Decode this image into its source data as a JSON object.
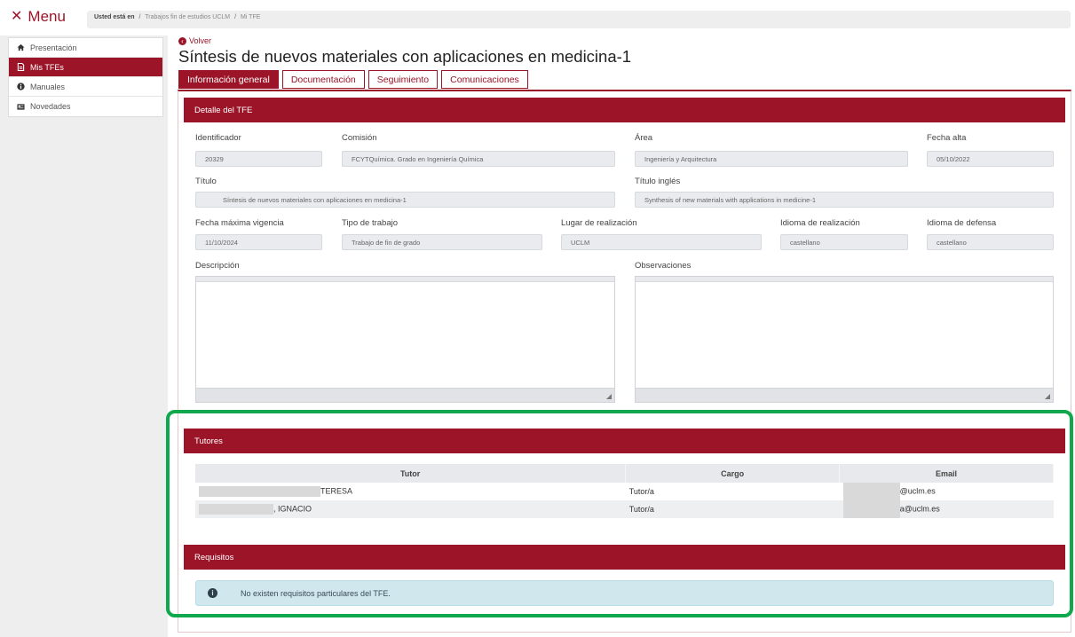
{
  "header": {
    "menu_label": "Menu",
    "breadcrumb": {
      "lead": "Usted está en",
      "sep": "/",
      "items": [
        "Trabajos fin de estudios UCLM",
        "Mi TFE"
      ]
    }
  },
  "sidebar": {
    "items": [
      {
        "label": "Presentación",
        "icon": "home-icon"
      },
      {
        "label": "Mis TFEs",
        "icon": "document-icon",
        "active": true
      },
      {
        "label": "Manuales",
        "icon": "info-icon"
      },
      {
        "label": "Novedades",
        "icon": "news-icon"
      }
    ]
  },
  "main": {
    "back_label": "Volver",
    "title": "Síntesis de nuevos materiales con aplicaciones en medicina-1",
    "tabs": [
      "Información general",
      "Documentación",
      "Seguimiento",
      "Comunicaciones"
    ]
  },
  "detalle": {
    "heading": "Detalle del TFE",
    "identificador": {
      "label": "Identificador",
      "value": "20329"
    },
    "comision": {
      "label": "Comisión",
      "value": "FCYTQuímica. Grado en Ingeniería Química"
    },
    "area": {
      "label": "Área",
      "value": "Ingeniería y Arquitectura"
    },
    "fecha_alta": {
      "label": "Fecha alta",
      "value": "05/10/2022"
    },
    "titulo": {
      "label": "Título",
      "value": "Síntesis de nuevos materiales con aplicaciones en medicina-1"
    },
    "titulo_ingles": {
      "label": "Título inglés",
      "value": "Synthesis of new materials with applications in medicine-1"
    },
    "fecha_maxima": {
      "label": "Fecha máxima vigencia",
      "value": "11/10/2024"
    },
    "tipo_trabajo": {
      "label": "Tipo de trabajo",
      "value": "Trabajo de fin de grado"
    },
    "lugar": {
      "label": "Lugar de realización",
      "value": "UCLM"
    },
    "idioma_realizacion": {
      "label": "Idioma de realización",
      "value": "castellano"
    },
    "idioma_defensa": {
      "label": "Idioma de defensa",
      "value": "castellano"
    },
    "descripcion": {
      "label": "Descripción",
      "value": ""
    },
    "observaciones": {
      "label": "Observaciones",
      "value": ""
    }
  },
  "tutores": {
    "heading": "Tutores",
    "columns": [
      "Tutor",
      "Cargo",
      "Email"
    ],
    "rows": [
      {
        "tutor": "TERESA",
        "cargo": "Tutor/a",
        "email": "@uclm.es"
      },
      {
        "tutor": ", IGNACIO",
        "cargo": "Tutor/a",
        "email": "a@uclm.es"
      }
    ]
  },
  "requisitos": {
    "heading": "Requisitos",
    "message": "No existen requisitos particulares del TFE."
  },
  "colors": {
    "brand": "#9b1428",
    "highlight": "#10a84c",
    "info_bg": "#cfe7ed"
  }
}
